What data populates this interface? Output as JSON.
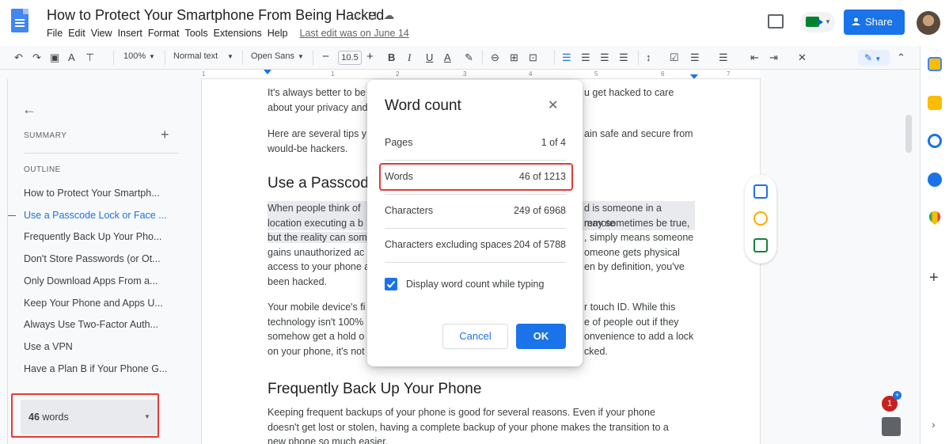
{
  "header": {
    "doc_title": "How to Protect Your Smartphone From Being Hacked",
    "menu": [
      "File",
      "Edit",
      "View",
      "Insert",
      "Format",
      "Tools",
      "Extensions",
      "Help"
    ],
    "last_edit": "Last edit was on June 14",
    "share_label": "Share"
  },
  "toolbar": {
    "zoom": "100%",
    "style": "Normal text",
    "font": "Open Sans",
    "font_size": "10.5"
  },
  "ruler": {
    "marks": [
      "1",
      "1",
      "2",
      "3",
      "4",
      "5",
      "6",
      "7"
    ]
  },
  "sidebar": {
    "summary_label": "SUMMARY",
    "outline_label": "OUTLINE",
    "outline_items": [
      "How to Protect Your Smartph...",
      "Use a Passcode Lock or Face ...",
      "Frequently Back Up Your Pho...",
      "Don't Store Passwords (or Ot...",
      "Only Download Apps From a...",
      "Keep Your Phone and Apps U...",
      "Always Use Two-Factor Auth...",
      "Use a VPN",
      "Have a Plan B if Your Phone G..."
    ],
    "word_count_number": "46",
    "word_count_unit": " words"
  },
  "document": {
    "p1": "It's always better to be proactive rather than wait until you get hacked to care about your privacy and security.",
    "p1_left_l1": "It's always better to be",
    "p1_right_l1": "u get hacked to care",
    "p1_left_l2": "about your privacy and",
    "p2_left_l1": "Here are several tips y",
    "p2_right_l1": "ain safe and secure from",
    "p2_left_l2": "would-be hackers.",
    "h1": "Use a Passcode",
    "p3_l1_left": "When people think of",
    "p3_l1_right": "d is someone in a remote",
    "p3_l2_left": "location executing a b",
    "p3_l2_right": "may sometimes be true,",
    "p3_l3_left": "but the reality can som",
    "p3_l3_right": ", simply means someone",
    "p3_l4_left": "gains unauthorized ac",
    "p3_l4_right": "omeone gets physical",
    "p3_l5_left": "access to your phone a",
    "p3_l5_right": "en by definition, you've",
    "p3_l6_left": "been hacked.",
    "p4_l1_left": "Your mobile device's fi",
    "p4_l1_right": "r touch ID. While this",
    "p4_l2_left": "technology isn't 100%",
    "p4_l2_right": "e of people out if they",
    "p4_l3_left": "somehow get a hold o",
    "p4_l3_right": "onvenience to add a lock",
    "p4_l4_left": "on your phone, it's not",
    "p4_l4_right": "cked.",
    "h2": "Frequently Back Up Your Phone",
    "p5_l1": "Keeping frequent backups of your phone is good for several reasons. Even if your phone",
    "p5_l2": "doesn't get lost or stolen, having a complete backup of your phone makes the transition to a",
    "p5_l3": "new phone so much easier."
  },
  "modal": {
    "title": "Word count",
    "rows": [
      {
        "label": "Pages",
        "value": "1 of 4"
      },
      {
        "label": "Words",
        "value": "46 of 1213"
      },
      {
        "label": "Characters",
        "value": "249 of 6968"
      },
      {
        "label": "Characters excluding spaces",
        "value": "204 of 5788"
      }
    ],
    "checkbox_label": "Display word count while typing",
    "checkbox_checked": true,
    "cancel_label": "Cancel",
    "ok_label": "OK"
  },
  "notifications": {
    "count": "1"
  },
  "colors": {
    "accent": "#1a73e8",
    "highlight_box": "#e53935"
  }
}
